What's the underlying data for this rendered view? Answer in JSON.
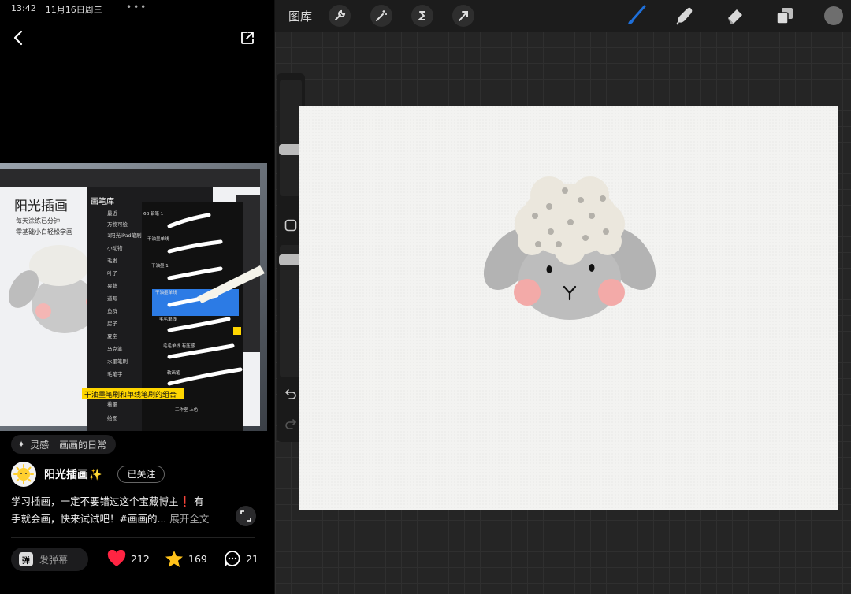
{
  "status": {
    "time": "13:42",
    "date": "11月16日周三",
    "dots": "•••"
  },
  "media": {
    "menu_title": "画笔库",
    "categories": [
      "最近",
      "万物可绘",
      "1阳光iPad笔刷",
      "小动物",
      "毛发",
      "叶子",
      "果蔬",
      "道写",
      "鱼群",
      "房子",
      "夏空",
      "马克笔",
      "水墨笔刷",
      "毛笔字",
      "着墨",
      "绘图"
    ],
    "brushes": [
      "6B 铅笔 1",
      "干油墨单线",
      "干油墨 1",
      "干油墨单线",
      "毛毛单线",
      "毛毛单线 有压感",
      "软画笔",
      "工作室 上色"
    ],
    "header_title": "阳光插画",
    "header_sub1": "每天涂练已分钟",
    "header_sub2": "零基础小白轻松学画",
    "caption": "干油墨笔刷和单线笔刷的组合"
  },
  "tag": {
    "label": "灵感",
    "topic": "画画的日常"
  },
  "author": {
    "name": "阳光插画✨",
    "follow_label": "已关注"
  },
  "description": {
    "line1": "学习插画，一定不要错过这个宝藏博主",
    "flag": "❗",
    "line1b": " 有",
    "line2": "手就会画，快来试试吧！#画画的...",
    "more": " 展开全文"
  },
  "actions": {
    "danmu_icon": "弹",
    "danmu_label": "发弹幕",
    "likes": "212",
    "stars": "169",
    "comments": "21"
  },
  "procreate": {
    "gallery_label": "图库",
    "icons": [
      "wrench-icon",
      "magic-wand-icon",
      "selection-icon",
      "transform-arrow-icon",
      "brush-icon",
      "smudge-icon",
      "eraser-icon",
      "layers-icon"
    ],
    "active_tool": "brush",
    "brush_color": "#1e6fd9",
    "color_well": "#6e6e6e"
  },
  "colors": {
    "accent_like": "#ff2442",
    "accent_star": "#ffc21a",
    "sheep_wool": "#ebe7dd",
    "sheep_face": "#bdbdbd",
    "cheek": "#f3aaa8"
  }
}
